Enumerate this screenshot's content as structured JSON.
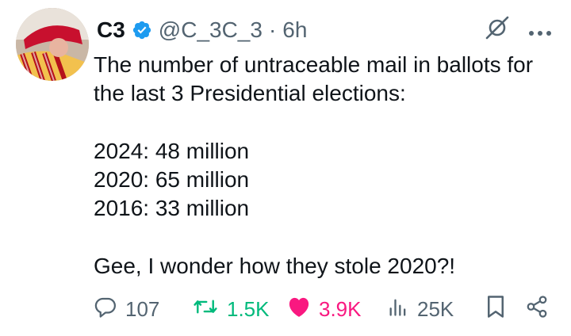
{
  "author": {
    "name": "C3",
    "handle": "@C_3C_3",
    "separator": "·",
    "time": "6h"
  },
  "tweet": {
    "intro": "The number of untraceable mail in ballots for the last 3 Presidential elections:",
    "lines": [
      "2024: 48 million",
      "2020: 65 million",
      "2016: 33 million"
    ],
    "closing": "Gee, I wonder how they stole 2020?!"
  },
  "actions": {
    "replies": "107",
    "reposts": "1.5K",
    "likes": "3.9K",
    "views": "25K"
  },
  "icons": {
    "verified": "verified-badge-icon",
    "grok": "grok-icon",
    "more": "more-icon",
    "reply": "reply-icon",
    "repost": "repost-icon",
    "like": "heart-icon",
    "views": "views-icon",
    "bookmark": "bookmark-icon",
    "share": "share-icon"
  },
  "colors": {
    "verified": "#1d9bf0",
    "repost": "#00ba7c",
    "like": "#f91880",
    "muted": "#536471",
    "text": "#0f1419"
  }
}
